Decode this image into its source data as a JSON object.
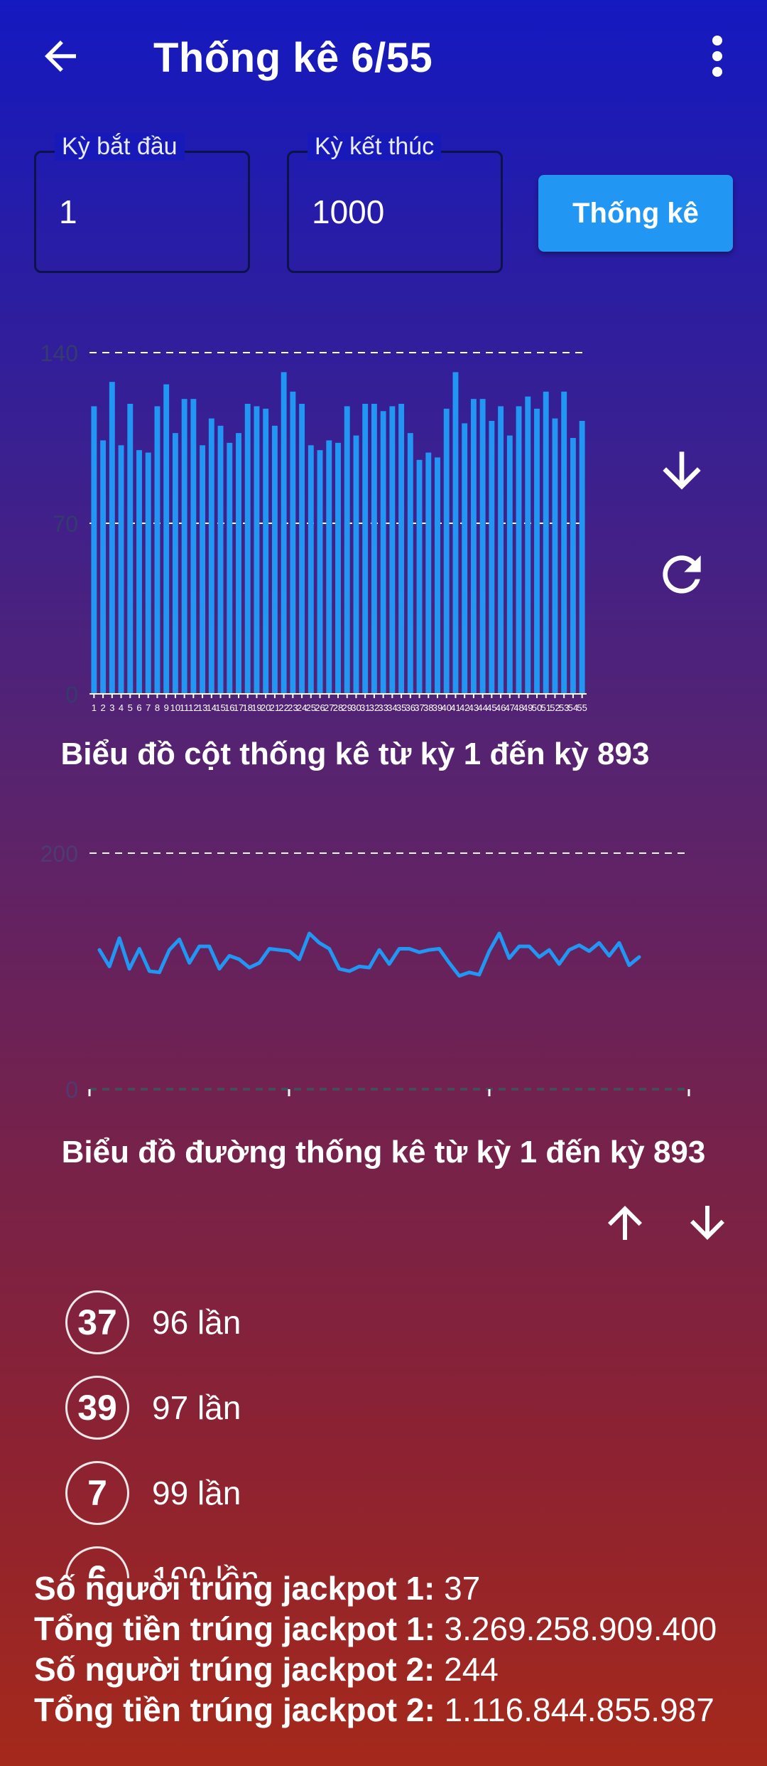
{
  "app": {
    "title": "Thống kê 6/55"
  },
  "form": {
    "start_label": "Kỳ bắt đầu",
    "start_value": "1",
    "end_label": "Kỳ kết thúc",
    "end_value": "1000",
    "submit_label": "Thống kê"
  },
  "bar_chart": {
    "caption": "Biểu đồ cột thống kê từ kỳ 1 đến kỳ  893",
    "y_ticks": [
      "0",
      "70",
      "140"
    ]
  },
  "line_chart": {
    "caption": "Biểu đồ đường thống kê từ kỳ 1 đến kỳ  893",
    "y_ticks": [
      "0",
      "200"
    ]
  },
  "icons": {
    "back": "arrow-back-icon",
    "more": "more-vert-icon",
    "download": "arrow-down-icon",
    "refresh": "refresh-icon",
    "sort_up": "arrow-up-icon",
    "sort_down": "arrow-down-icon"
  },
  "colors": {
    "accent": "#2196f3",
    "bar": "#2196f3",
    "line": "#2196f3"
  },
  "frequency_list": [
    {
      "number": "37",
      "times": "96 lần"
    },
    {
      "number": "39",
      "times": "97 lần"
    },
    {
      "number": "7",
      "times": "99 lần"
    },
    {
      "number": "6",
      "times": "100 lần"
    }
  ],
  "summary": {
    "jackpot1_winners_label": "Số người trúng jackpot 1:",
    "jackpot1_winners_value": " 37",
    "jackpot1_total_label": "Tổng tiền trúng jackpot 1:",
    "jackpot1_total_value": " 3.269.258.909.400",
    "jackpot2_winners_label": "Số người trúng jackpot 2:",
    "jackpot2_winners_value": " 244",
    "jackpot2_total_label": "Tổng tiền trúng jackpot 2:",
    "jackpot2_total_value": " 1.116.844.855.987"
  },
  "chart_data": [
    {
      "type": "bar",
      "categories": [
        "1",
        "2",
        "3",
        "4",
        "5",
        "6",
        "7",
        "8",
        "9",
        "10",
        "11",
        "12",
        "13",
        "14",
        "15",
        "16",
        "17",
        "18",
        "19",
        "20",
        "21",
        "22",
        "23",
        "24",
        "25",
        "26",
        "27",
        "28",
        "29",
        "30",
        "31",
        "32",
        "33",
        "34",
        "35",
        "36",
        "37",
        "38",
        "39",
        "40",
        "41",
        "42",
        "43",
        "44",
        "45",
        "46",
        "47",
        "48",
        "49",
        "50",
        "51",
        "52",
        "53",
        "54",
        "55"
      ],
      "values": [
        118,
        104,
        128,
        102,
        119,
        100,
        99,
        118,
        127,
        107,
        121,
        121,
        102,
        113,
        110,
        103,
        107,
        119,
        118,
        117,
        110,
        132,
        124,
        119,
        102,
        100,
        104,
        103,
        118,
        106,
        119,
        119,
        116,
        118,
        119,
        107,
        96,
        99,
        97,
        117,
        132,
        111,
        121,
        121,
        112,
        118,
        106,
        118,
        122,
        117,
        124,
        113,
        124,
        105,
        112
      ],
      "ylim": [
        0,
        140
      ],
      "y_ticks": [
        0,
        70,
        140
      ],
      "grid": "dashed horizontal at ticks"
    },
    {
      "type": "line",
      "x": [
        1,
        2,
        3,
        4,
        5,
        6,
        7,
        8,
        9,
        10,
        11,
        12,
        13,
        14,
        15,
        16,
        17,
        18,
        19,
        20,
        21,
        22,
        23,
        24,
        25,
        26,
        27,
        28,
        29,
        30,
        31,
        32,
        33,
        34,
        35,
        36,
        37,
        38,
        39,
        40,
        41,
        42,
        43,
        44,
        45,
        46,
        47,
        48,
        49,
        50,
        51,
        52,
        53,
        54,
        55
      ],
      "values": [
        118,
        104,
        128,
        102,
        119,
        100,
        99,
        118,
        127,
        107,
        121,
        121,
        102,
        113,
        110,
        103,
        107,
        119,
        118,
        117,
        110,
        132,
        124,
        119,
        102,
        100,
        104,
        103,
        118,
        106,
        119,
        119,
        116,
        118,
        119,
        107,
        96,
        99,
        97,
        117,
        132,
        111,
        121,
        121,
        112,
        118,
        106,
        118,
        122,
        117,
        124,
        113,
        124,
        105,
        112
      ],
      "ylim": [
        0,
        200
      ],
      "y_ticks": [
        0,
        200
      ],
      "grid": "dashed horizontal at ticks"
    }
  ]
}
